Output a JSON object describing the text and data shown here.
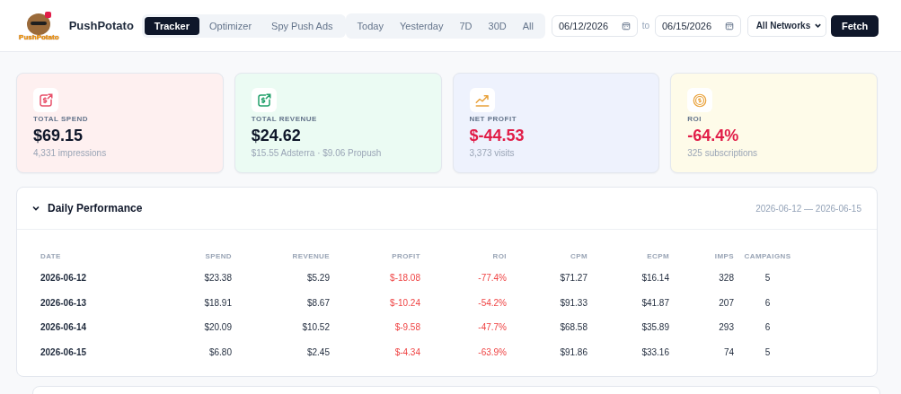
{
  "header": {
    "logo_text": "PushPotato",
    "brand": "PushPotato",
    "tabs": [
      {
        "label": "Tracker",
        "selected": true
      },
      {
        "label": "Optimizer",
        "selected": false
      },
      {
        "label": "Spy Push Ads",
        "selected": false
      }
    ],
    "ranges": [
      {
        "label": "Today",
        "selected": false
      },
      {
        "label": "Yesterday",
        "selected": false
      },
      {
        "label": "7D",
        "selected": false
      },
      {
        "label": "30D",
        "selected": false
      },
      {
        "label": "All",
        "selected": false
      }
    ],
    "date_from": "06/12/2026",
    "date_separator": "to",
    "date_to": "06/15/2026",
    "network": "All Networks",
    "fetch_button": "Fetch"
  },
  "cards": [
    {
      "kind": "spend",
      "color": "#fef0f0",
      "label": "TOTAL SPEND",
      "value": "$69.15",
      "negative": false,
      "note": "4,331 impressions"
    },
    {
      "kind": "revenue",
      "color": "#ebfbf3",
      "label": "TOTAL REVENUE",
      "value": "$24.62",
      "negative": false,
      "note": "$15.55 Adsterra · $9.06 Propush"
    },
    {
      "kind": "profit",
      "color": "#eef2fd",
      "label": "NET PROFIT",
      "value": "$-44.53",
      "negative": true,
      "note": "3,373 visits"
    },
    {
      "kind": "roi",
      "color": "#fefbe9",
      "label": "ROI",
      "value": "-64.4%",
      "negative": true,
      "note": "325 subscriptions"
    }
  ],
  "performance": {
    "title": "Daily Performance",
    "expanded": true,
    "range": "2026-06-12 — 2026-06-15",
    "columns": [
      "DATE",
      "SPEND",
      "REVENUE",
      "PROFIT",
      "ROI",
      "CPM",
      "ECPM",
      "IMPS",
      "CAMPAIGNS"
    ],
    "rows": [
      {
        "negative": true,
        "cells": [
          "2026-06-12",
          "$23.38",
          "$5.29",
          "$-18.08",
          "-77.4%",
          "$71.27",
          "$16.14",
          "328",
          "5"
        ]
      },
      {
        "negative": true,
        "cells": [
          "2026-06-13",
          "$18.91",
          "$8.67",
          "$-10.24",
          "-54.2%",
          "$91.33",
          "$41.87",
          "207",
          "6"
        ]
      },
      {
        "negative": true,
        "cells": [
          "2026-06-14",
          "$20.09",
          "$10.52",
          "$-9.58",
          "-47.7%",
          "$68.58",
          "$35.89",
          "293",
          "6"
        ]
      },
      {
        "negative": true,
        "cells": [
          "2026-06-15",
          "$6.80",
          "$2.45",
          "$-4.34",
          "-63.9%",
          "$91.86",
          "$33.16",
          "74",
          "5"
        ]
      }
    ]
  }
}
